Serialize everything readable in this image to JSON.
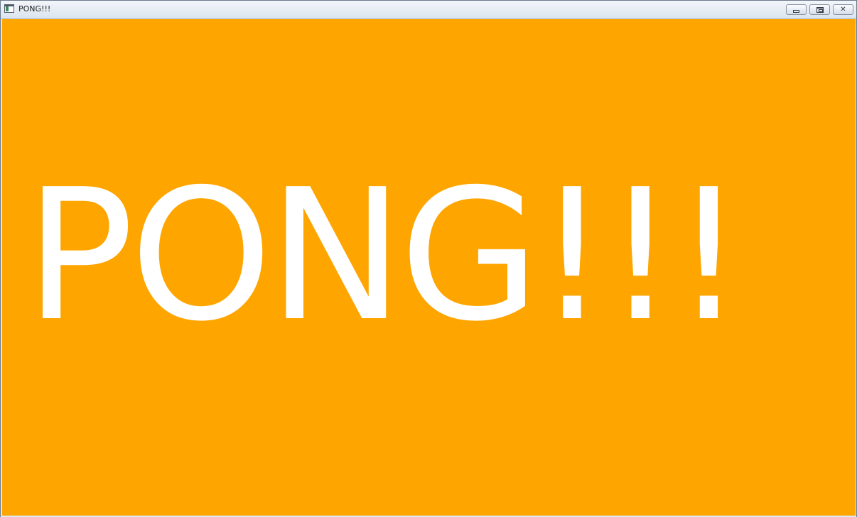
{
  "window": {
    "title": "PONG!!!",
    "controls": {
      "minimize_icon": "minimize-icon",
      "maximize_icon": "maximize-icon",
      "close_label": "✕"
    }
  },
  "game": {
    "title_text": "PONG!!!",
    "background_color": "#FFA500",
    "text_color": "#FFFFFF"
  }
}
